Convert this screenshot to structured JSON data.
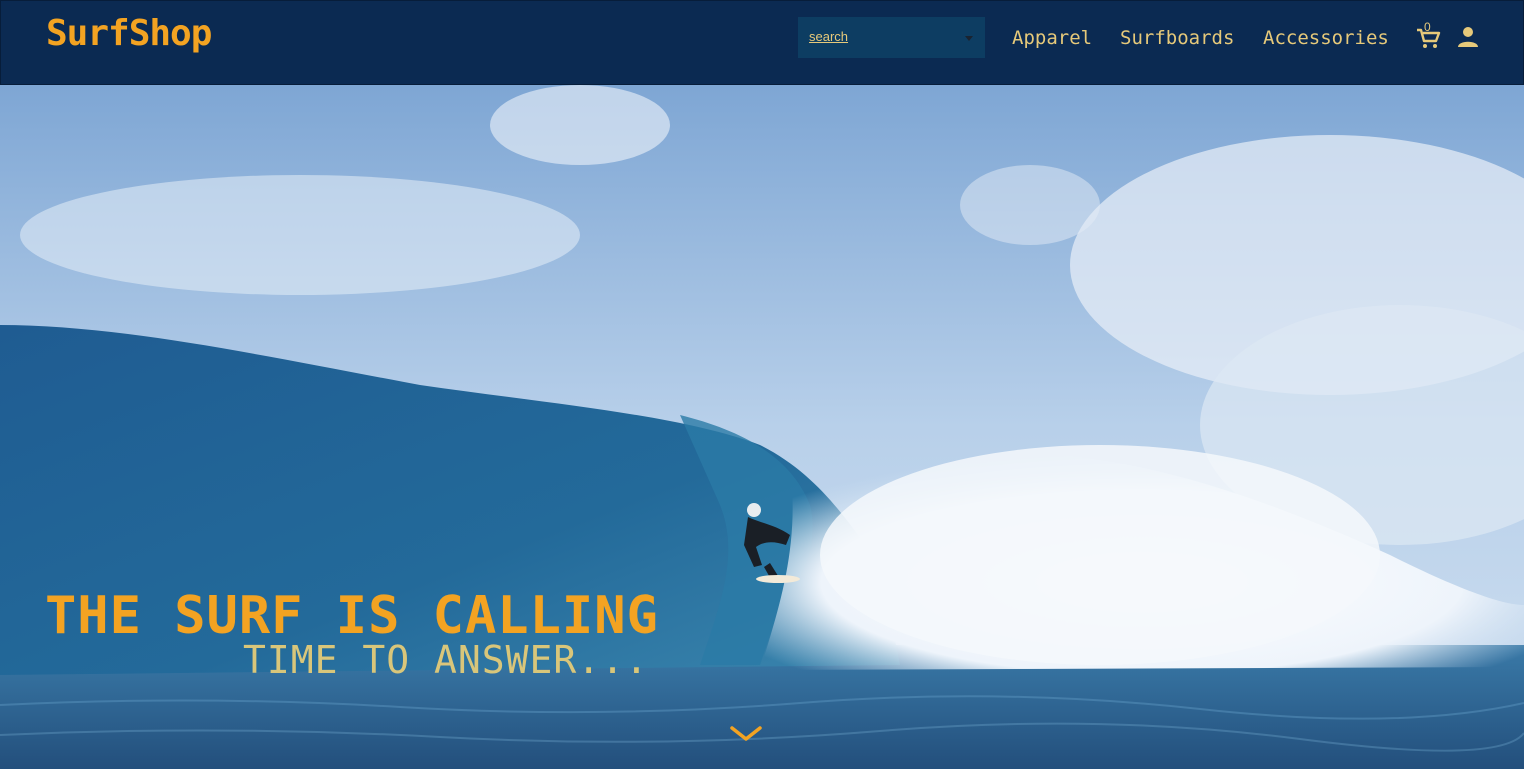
{
  "brand": {
    "logo_text": "SurfShop",
    "accent_color": "#f3a322",
    "nav_bg": "#0b2a52"
  },
  "search": {
    "placeholder": "search"
  },
  "nav": {
    "links": [
      {
        "label": "Apparel"
      },
      {
        "label": "Surfboards"
      },
      {
        "label": "Accessories"
      }
    ],
    "cart": {
      "icon": "cart-icon",
      "count": "0"
    },
    "account": {
      "icon": "person-icon"
    }
  },
  "hero": {
    "headline": "THE SURF IS CALLING",
    "subheadline": "TIME TO ANSWER...",
    "scroll_icon": "chevron-down-icon",
    "image": "surfer riding inside a breaking wave"
  }
}
